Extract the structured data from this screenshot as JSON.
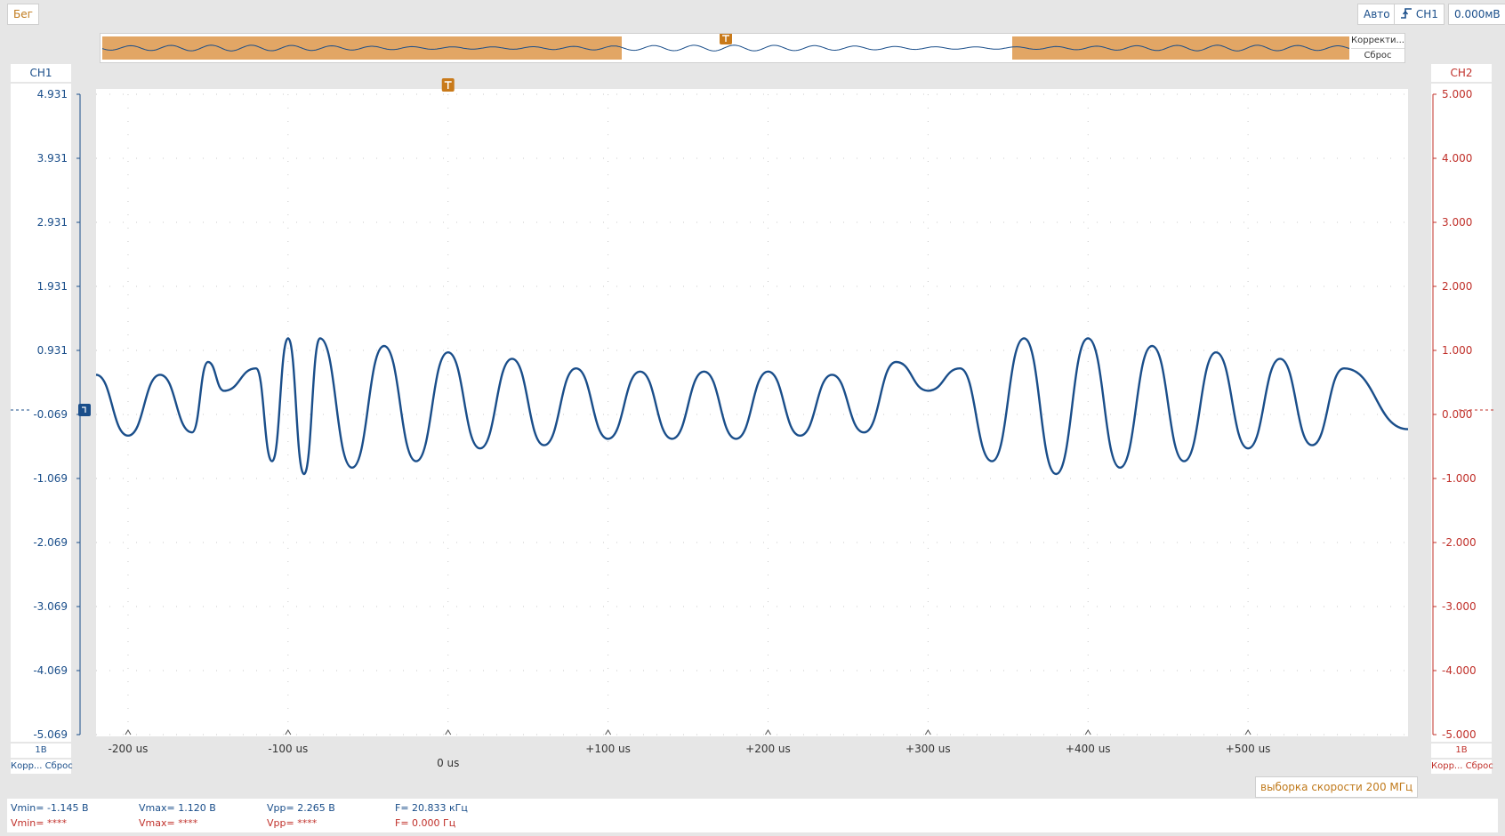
{
  "toolbar": {
    "run_label": "Бег",
    "mode_label": "Авто",
    "trigger_source": "CH1",
    "trigger_level": "0.000мВ"
  },
  "overview": {
    "correct_label": "Корректи...",
    "reset_label": "Сброс"
  },
  "ch1": {
    "name": "CH1",
    "scale": "1В",
    "actions": "Корр... Сброс",
    "ticks": [
      "4.931",
      "3.931",
      "2.931",
      "1.931",
      "0.931",
      "-0.069",
      "-1.069",
      "-2.069",
      "-3.069",
      "-4.069",
      "-5.069"
    ]
  },
  "ch2": {
    "name": "CH2",
    "scale": "1В",
    "actions": "Корр... Сброс",
    "ticks": [
      "5.000",
      "4.000",
      "3.000",
      "2.000",
      "1.000",
      "0.000",
      "-1.000",
      "-2.000",
      "-3.000",
      "-4.000",
      "-5.000"
    ]
  },
  "xaxis": {
    "ticks": [
      "-200 us",
      "-100 us",
      "0 us",
      "+100 us",
      "+200 us",
      "+300 us",
      "+400 us",
      "+500 us"
    ],
    "tick_values": [
      -200,
      -100,
      0,
      100,
      200,
      300,
      400,
      500
    ],
    "xlim": [
      -220,
      600
    ]
  },
  "status": {
    "sample_rate": "выборка скорости 200 МГц"
  },
  "measurements": {
    "ch1": {
      "vmin": "Vmin= -1.145 В",
      "vmax": "Vmax= 1.120 В",
      "vpp": "Vpp= 2.265 В",
      "freq": "F= 20.833 кГц"
    },
    "ch2": {
      "vmin": "Vmin= ****",
      "vmax": "Vmax= ****",
      "vpp": "Vpp= ****",
      "freq": "F= 0.000 Гц"
    }
  },
  "colors": {
    "ch1": "#1a4e8a",
    "ch2": "#c0302a",
    "trigger": "#c97a1a",
    "window": "#e2a665"
  },
  "chart_data": {
    "type": "line",
    "series": [
      {
        "name": "CH1",
        "x": [
          -220,
          -200,
          -180,
          -160,
          -150,
          -140,
          -120,
          -110,
          -100,
          -90,
          -80,
          -60,
          -40,
          -20,
          0,
          20,
          40,
          60,
          80,
          100,
          120,
          140,
          160,
          180,
          200,
          220,
          240,
          260,
          280,
          300,
          320,
          340,
          360,
          380,
          400,
          420,
          440,
          460,
          480,
          500,
          520,
          540,
          560,
          600
        ],
        "y": [
          0.55,
          -0.4,
          0.55,
          -0.35,
          0.75,
          0.3,
          0.65,
          -0.8,
          1.12,
          -1.0,
          1.12,
          -0.9,
          1.0,
          -0.8,
          0.9,
          -0.6,
          0.8,
          -0.55,
          0.65,
          -0.45,
          0.6,
          -0.45,
          0.6,
          -0.45,
          0.6,
          -0.4,
          0.55,
          -0.35,
          0.75,
          0.3,
          0.65,
          -0.8,
          1.12,
          -1.0,
          1.12,
          -0.9,
          1.0,
          -0.8,
          0.9,
          -0.6,
          0.8,
          -0.55,
          0.65,
          -0.3
        ]
      }
    ],
    "ylim": [
      -5.069,
      4.931
    ],
    "xlim": [
      -220,
      600
    ],
    "x_unit": "us",
    "frequency_khz": 20.833,
    "trigger_time_us": 0,
    "trigger_level_mv": 0,
    "grid": "dotted"
  }
}
